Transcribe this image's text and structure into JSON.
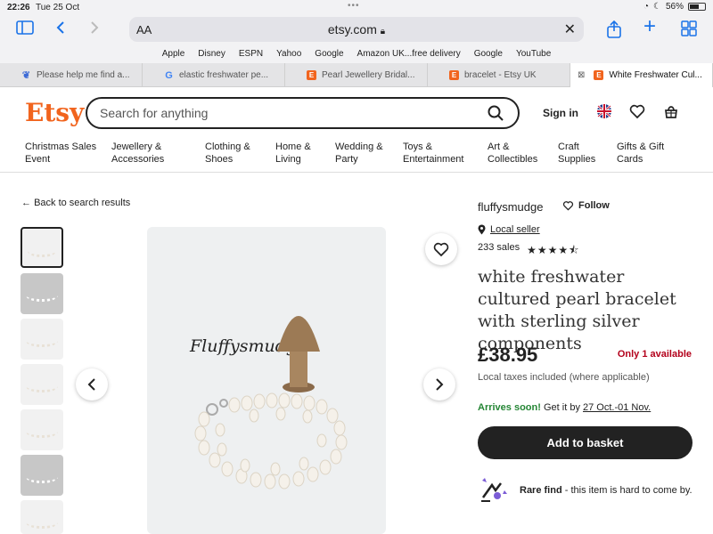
{
  "status_bar": {
    "time": "22:26",
    "date": "Tue 25 Oct",
    "battery": "56%"
  },
  "browser": {
    "aa_label": "AA",
    "url": "etsy.com",
    "favorites": [
      "Apple",
      "Disney",
      "ESPN",
      "Yahoo",
      "Google",
      "Amazon UK...free delivery",
      "Google",
      "YouTube"
    ],
    "tabs": [
      {
        "label": "Please help me find a...",
        "icon": "leaf-icon",
        "color": "#3c6ad6"
      },
      {
        "label": "elastic freshwater pe...",
        "icon": "google-icon",
        "color": "#4285f4"
      },
      {
        "label": "Pearl Jewellery Bridal...",
        "icon": "etsy-icon",
        "color": "#f1641e"
      },
      {
        "label": "bracelet - Etsy UK",
        "icon": "etsy-icon",
        "color": "#f1641e"
      },
      {
        "label": "White Freshwater Cul...",
        "icon": "etsy-icon",
        "color": "#f1641e"
      }
    ]
  },
  "header": {
    "logo": "Etsy",
    "search_placeholder": "Search for anything",
    "signin": "Sign in"
  },
  "categories": [
    [
      "Christmas Sales",
      "Event"
    ],
    [
      "Jewellery &",
      "Accessories"
    ],
    [
      "Clothing &",
      "Shoes"
    ],
    [
      "Home &",
      "Living"
    ],
    [
      "Wedding &",
      "Party"
    ],
    [
      "Toys &",
      "Entertainment"
    ],
    [
      "Art &",
      "Collectibles"
    ],
    [
      "Craft",
      "Supplies"
    ],
    [
      "Gifts & Gift",
      "Cards"
    ]
  ],
  "listing": {
    "back_label": "Back to search results",
    "image_brand": "Fluffysmudge",
    "shop_name": "fluffysmudge",
    "follow_label": "Follow",
    "local_seller": "Local seller",
    "sales": "233 sales",
    "rating": 4.5,
    "title": "white freshwater cultured pearl bracelet with sterling silver components",
    "price": "£38.95",
    "availability": "Only 1 available",
    "tax_note": "Local taxes included (where applicable)",
    "arrives_label": "Arrives soon!",
    "arrives_text": "Get it by",
    "arrives_date": "27 Oct.-01 Nov.",
    "basket_label": "Add to basket",
    "rare_label": "Rare find",
    "rare_text": "- this item is hard to come by."
  },
  "colors": {
    "brand": "#f1641e",
    "available_red": "#b3001b",
    "arrives_green": "#258635",
    "ios_blue": "#1a73e8"
  }
}
